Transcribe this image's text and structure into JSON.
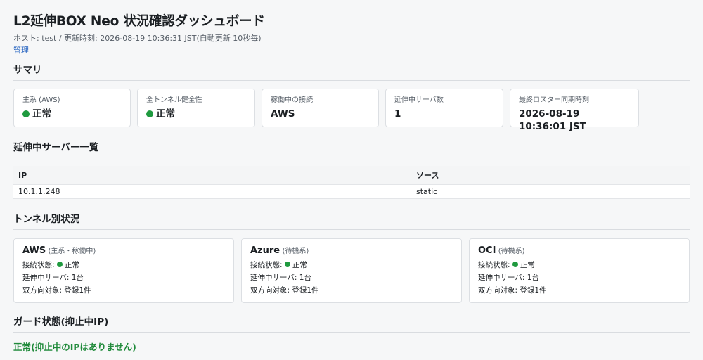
{
  "page": {
    "title": "L2延伸BOX Neo 状況確認ダッシュボード",
    "meta": "ホスト: test / 更新時刻: 2026-08-19 10:36:31 JST(自動更新 10秒毎)",
    "admin_link": "管理"
  },
  "summary": {
    "heading": "サマリ",
    "cards": [
      {
        "label": "主系 (AWS)",
        "value": "正常",
        "dot": true
      },
      {
        "label": "全トンネル健全性",
        "value": "正常",
        "dot": true
      },
      {
        "label": "稼働中の接続",
        "value": "AWS",
        "dot": false
      },
      {
        "label": "延伸中サーバ数",
        "value": "1",
        "dot": false
      },
      {
        "label": "最終ロスター同期時刻",
        "value": "2026-08-19 10:36:01 JST",
        "dot": false
      }
    ]
  },
  "servers": {
    "heading": "延伸中サーバー一覧",
    "columns": [
      "IP",
      "ソース"
    ],
    "rows": [
      [
        "10.1.1.248",
        "static"
      ]
    ]
  },
  "tunnels": {
    "heading": "トンネル別状況",
    "items": [
      {
        "name": "AWS",
        "role": "(主系・稼働中)",
        "conn_label": "接続状態:",
        "conn_value": "正常",
        "servers": "延伸中サーバ: 1台",
        "targets": "双方向対象: 登録1件"
      },
      {
        "name": "Azure",
        "role": "(待機系)",
        "conn_label": "接続状態:",
        "conn_value": "正常",
        "servers": "延伸中サーバ: 1台",
        "targets": "双方向対象: 登録1件"
      },
      {
        "name": "OCI",
        "role": "(待機系)",
        "conn_label": "接続状態:",
        "conn_value": "正常",
        "servers": "延伸中サーバ: 1台",
        "targets": "双方向対象: 登録1件"
      }
    ]
  },
  "guard": {
    "heading": "ガード状態(抑止中IP)",
    "status": "正常(抑止中のIPはありません)"
  },
  "colors": {
    "status_ok": "#1f9a3f",
    "link": "#1f5fbf"
  }
}
